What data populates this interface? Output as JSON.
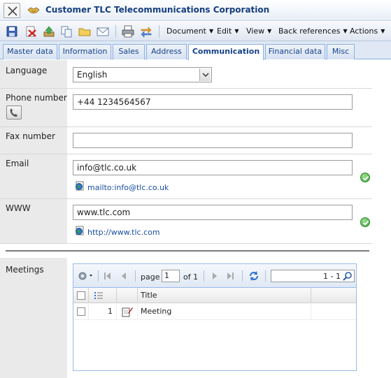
{
  "window": {
    "title": "Customer TLC Telecommunications Corporation"
  },
  "toolbar": {
    "icons": [
      "save-icon",
      "delete-icon",
      "upload-icon",
      "copy-icon",
      "folder-icon",
      "email-icon",
      "print-icon",
      "transfer-icon"
    ],
    "menus": {
      "document": "Document",
      "edit": "Edit",
      "view": "View",
      "back_references": "Back references",
      "actions": "Actions"
    }
  },
  "tabs": [
    "Master data",
    "Information",
    "Sales",
    "Address",
    "Communication",
    "Financial data",
    "Misc"
  ],
  "active_tab": "Communication",
  "form": {
    "language": {
      "label": "Language",
      "value": "English"
    },
    "phone": {
      "label": "Phone number",
      "value": "+44  1234564567"
    },
    "fax": {
      "label": "Fax number",
      "value": ""
    },
    "email": {
      "label": "Email",
      "value": "info@tlc.co.uk",
      "link": "mailto:info@tlc.co.uk"
    },
    "www": {
      "label": "WWW",
      "value": "www.tlc.com",
      "link": "http://www.tlc.com"
    }
  },
  "meetings": {
    "label": "Meetings",
    "pager": {
      "page_label": "page",
      "page_value": "1",
      "of_label": "of 1",
      "range": "1 - 1"
    },
    "columns": [
      "Title"
    ],
    "rows": [
      {
        "number": "1",
        "title": "Meeting"
      }
    ]
  },
  "colors": {
    "title_text": "#153e7e",
    "tab_text": "#15428b",
    "label_bg": "#eaeaea",
    "link": "#1a4fa0",
    "valid_check": "#3ba53a"
  }
}
